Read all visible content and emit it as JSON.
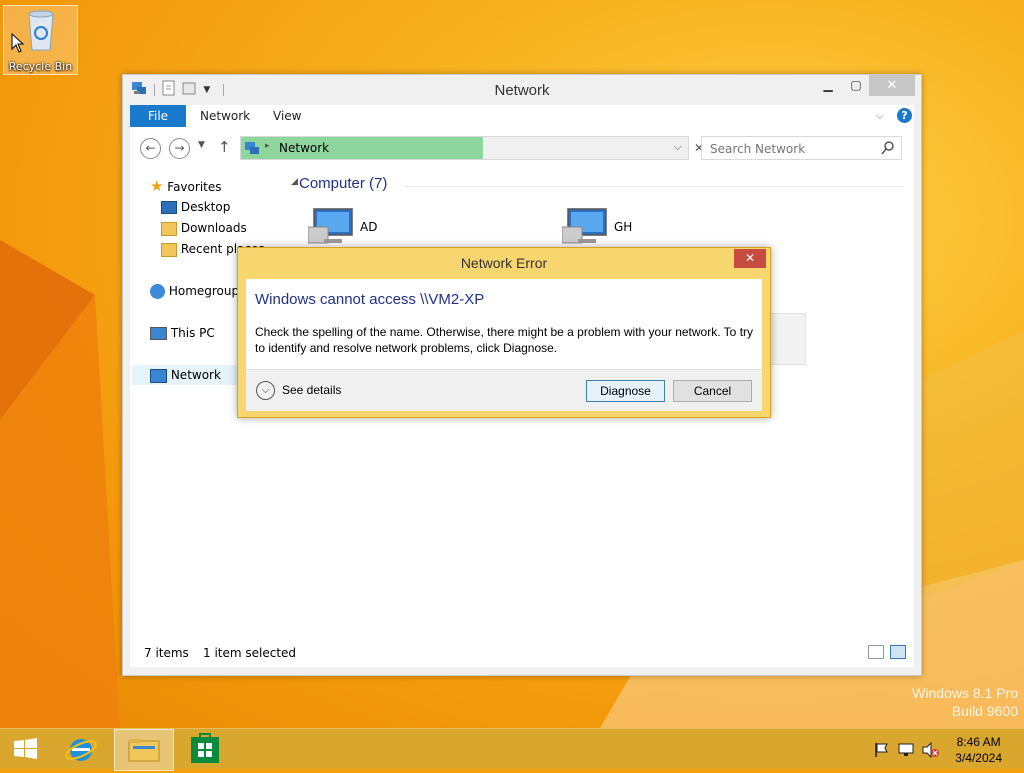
{
  "desktop": {
    "recycle_bin_label": "Recycle Bin",
    "watermark_line1": "Windows 8.1 Pro",
    "watermark_line2": "Build 9600"
  },
  "explorer": {
    "title": "Network",
    "ribbon_tabs": [
      "File",
      "Network",
      "View"
    ],
    "address_crumb": "Network",
    "search_placeholder": "Search Network",
    "nav": {
      "favorites": "Favorites",
      "desktop": "Desktop",
      "downloads": "Downloads",
      "recent": "Recent places",
      "homegroup": "Homegroup",
      "this_pc": "This PC",
      "network": "Network"
    },
    "group_header": "Computer (7)",
    "computers": [
      "AD",
      "GH"
    ],
    "status_items": "7 items",
    "status_selected": "1 item selected"
  },
  "dialog": {
    "title": "Network Error",
    "heading": "Windows cannot access \\\\VM2-XP",
    "message": "Check the spelling of the name. Otherwise, there might be a problem with your network. To try to identify and resolve network problems, click Diagnose.",
    "see_details": "See details",
    "diagnose_label": "Diagnose",
    "cancel_label": "Cancel"
  },
  "taskbar": {
    "time": "8:46 AM",
    "date": "3/4/2024"
  },
  "colors": {
    "accent_blue": "#1979ca",
    "dialog_frame": "#f7d56f",
    "heading_blue": "#1e3287",
    "address_fill": "#8fd69e",
    "close_red": "#c74b41"
  }
}
